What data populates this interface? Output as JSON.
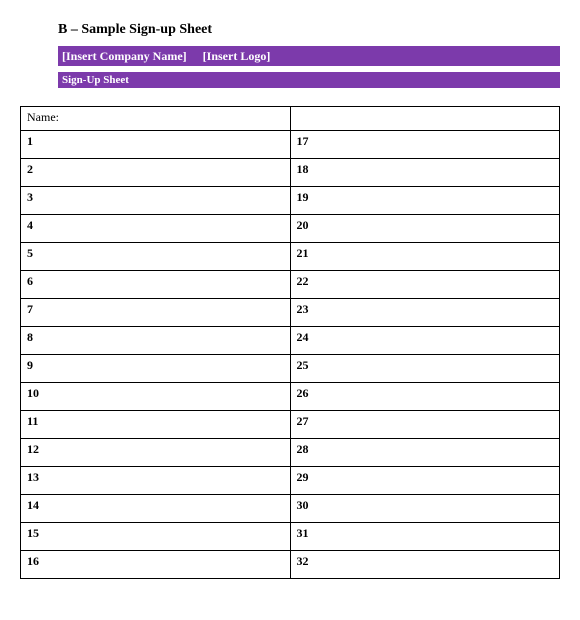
{
  "title": "B – Sample Sign-up Sheet",
  "banner": {
    "company": "[Insert Company Name]",
    "logo": "[Insert Logo]"
  },
  "subbanner": "Sign-Up Sheet",
  "table": {
    "name_label": "Name:",
    "left_numbers": [
      "1",
      "2",
      "3",
      "4",
      "5",
      "6",
      "7",
      "8",
      "9",
      "10",
      "11",
      "12",
      "13",
      "14",
      "15",
      "16"
    ],
    "right_numbers": [
      "17",
      "18",
      "19",
      "20",
      "21",
      "22",
      "23",
      "24",
      "25",
      "26",
      "27",
      "28",
      "29",
      "30",
      "31",
      "32"
    ]
  }
}
